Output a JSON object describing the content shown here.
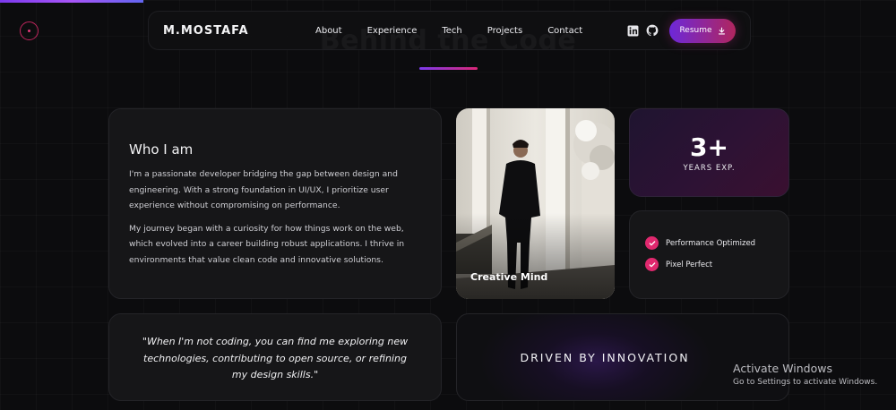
{
  "nav": {
    "brand": "M.MOSTAFA",
    "links": [
      "About",
      "Experience",
      "Tech",
      "Projects",
      "Contact"
    ],
    "resume_label": "Resume",
    "icons": [
      "linkedin-icon",
      "github-icon",
      "download-icon"
    ]
  },
  "section": {
    "title": "Behind the Code"
  },
  "who": {
    "heading": "Who I am",
    "paragraphs": [
      "I'm a passionate developer bridging the gap between design and engineering. With a strong foundation in UI/UX, I prioritize user experience without compromising on performance.",
      "My journey began with a curiosity for how things work on the web, which evolved into a career building robust applications. I thrive in environments that value clean code and innovative solutions."
    ]
  },
  "photo": {
    "caption": "Creative Mind"
  },
  "stats": {
    "years_value": "3+",
    "years_label": "YEARS EXP."
  },
  "features": [
    "Performance Optimized",
    "Pixel Perfect"
  ],
  "quote": {
    "text": "\"When I'm not coding, you can find me exploring new technologies, contributing to open source, or refining my design skills.\""
  },
  "driven": {
    "text": "DRIVEN BY INNOVATION"
  },
  "windows": {
    "title": "Activate Windows",
    "subtitle": "Go to Settings to activate Windows."
  },
  "colors": {
    "accent_purple": "#7c3aed",
    "accent_pink": "#e0286e",
    "background": "#0c0c0e",
    "card": "#161618"
  }
}
